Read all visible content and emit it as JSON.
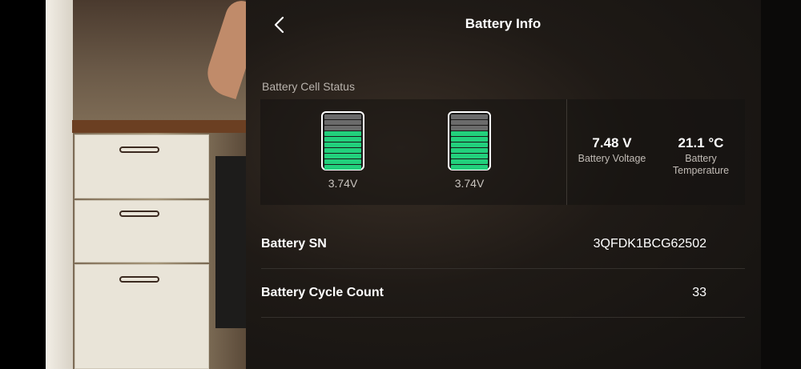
{
  "header": {
    "title": "Battery Info",
    "back_icon": "chevron-left-icon"
  },
  "cell_status": {
    "label": "Battery Cell Status",
    "cells": [
      {
        "voltage": "3.74V",
        "fill_segments": 7,
        "total_segments": 10
      },
      {
        "voltage": "3.74V",
        "fill_segments": 7,
        "total_segments": 10
      }
    ],
    "colors": {
      "filled": "#22d07c",
      "empty": "#6b6b6b"
    }
  },
  "stats": {
    "voltage_value": "7.48 V",
    "voltage_label": "Battery Voltage",
    "temperature_value": "21.1 °C",
    "temperature_label_line1": "Battery",
    "temperature_label_line2": "Temperature"
  },
  "info": {
    "serial_label": "Battery SN",
    "serial_value": "3QFDK1BCG62502",
    "cycle_label": "Battery Cycle Count",
    "cycle_value": "33"
  }
}
